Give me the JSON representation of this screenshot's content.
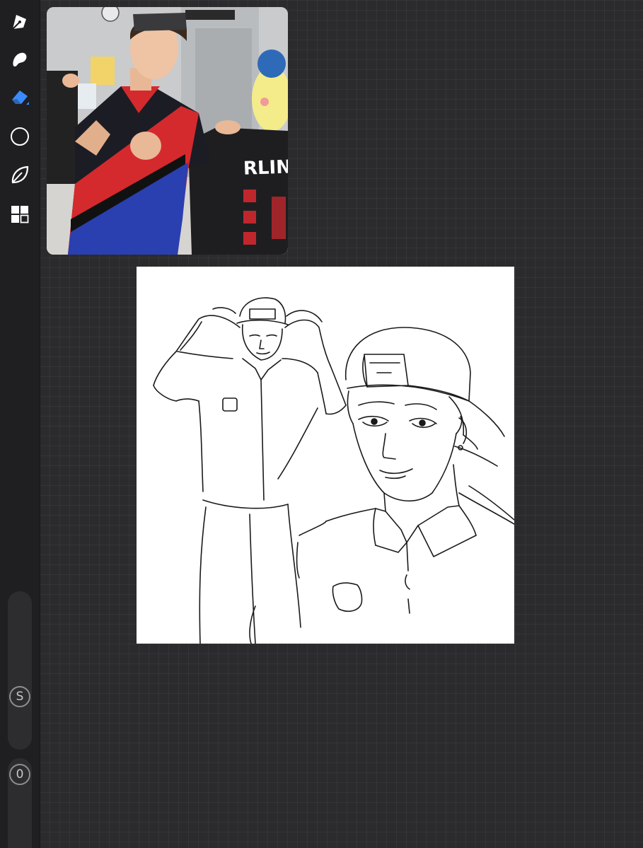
{
  "toolbar": {
    "tools": [
      {
        "name": "draw",
        "icon": "pen-nib-icon",
        "active": false
      },
      {
        "name": "smudge",
        "icon": "smudge-finger-icon",
        "active": false
      },
      {
        "name": "erase",
        "icon": "eraser-icon",
        "active": true
      },
      {
        "name": "select",
        "icon": "circle-select-icon",
        "active": false
      },
      {
        "name": "liquify",
        "icon": "leaf-icon",
        "active": false
      },
      {
        "name": "layers",
        "icon": "grid-layers-icon",
        "active": false
      }
    ],
    "size_label": "S",
    "opacity_label": "0"
  },
  "colors": {
    "active_tool": "#3a8bff",
    "inactive_tool": "#ffffff",
    "toolbar_bg": "#1f1f21",
    "workspace_bg": "#2b2b2d",
    "canvas_bg": "#ffffff"
  },
  "reference_image": {
    "shirt_text": "RLIN"
  }
}
